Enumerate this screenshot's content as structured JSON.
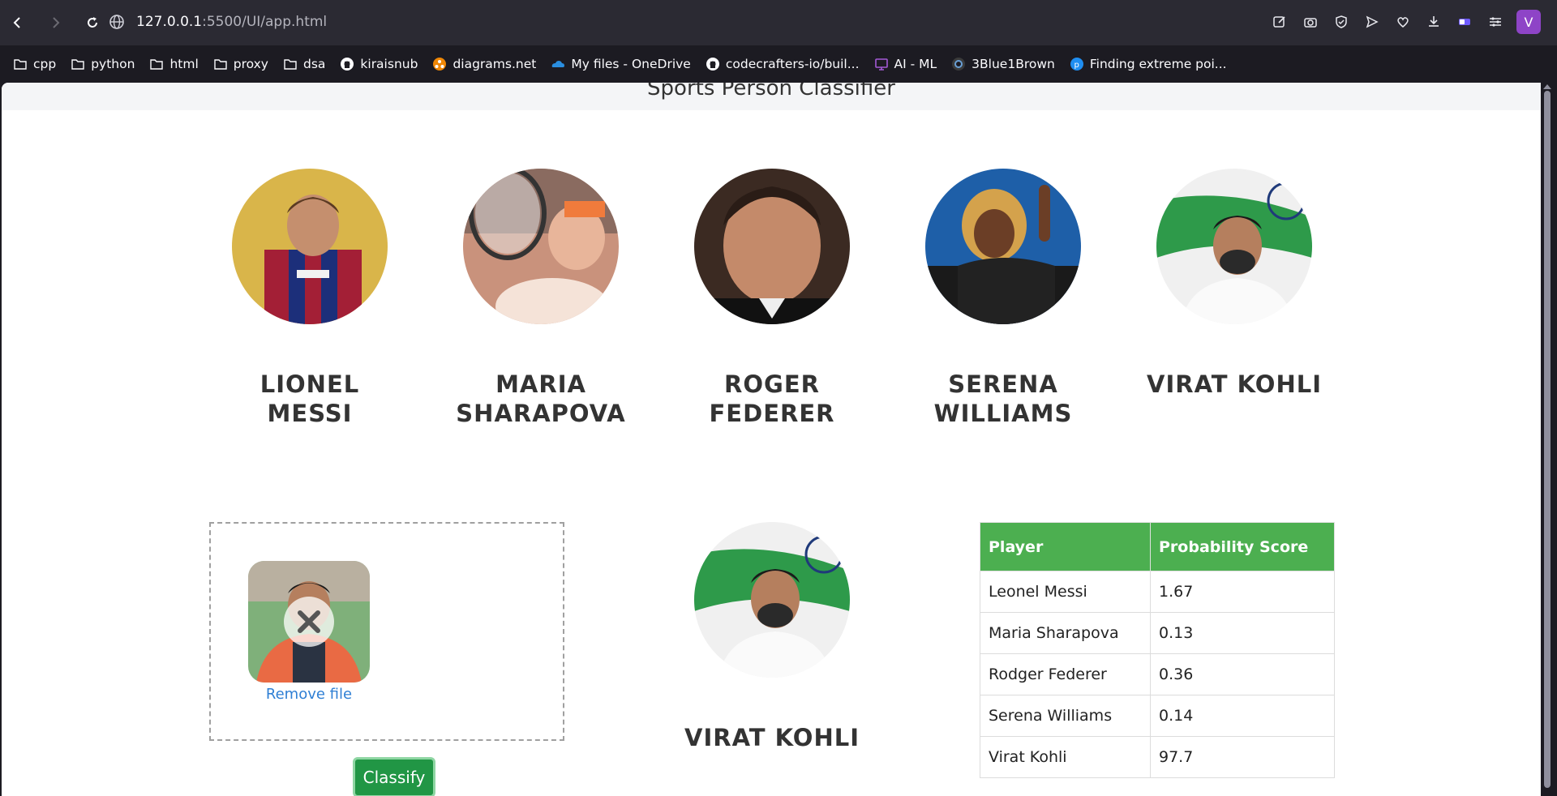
{
  "browser": {
    "url_host": "127.0.0.1",
    "url_rest": ":5500/UI/app.html",
    "profile_initial": "V",
    "bookmarks": [
      {
        "label": "cpp",
        "icon": "folder-icon"
      },
      {
        "label": "python",
        "icon": "folder-icon"
      },
      {
        "label": "html",
        "icon": "folder-icon"
      },
      {
        "label": "proxy",
        "icon": "folder-icon"
      },
      {
        "label": "dsa",
        "icon": "folder-icon"
      },
      {
        "label": "kiraisnub",
        "icon": "github-icon"
      },
      {
        "label": "diagrams.net",
        "icon": "diagrams-icon"
      },
      {
        "label": "My files - OneDrive",
        "icon": "onedrive-icon"
      },
      {
        "label": "codecrafters-io/buil...",
        "icon": "github-icon"
      },
      {
        "label": "AI - ML",
        "icon": "presentation-icon"
      },
      {
        "label": "3Blue1Brown",
        "icon": "3b1b-icon"
      },
      {
        "label": "Finding extreme poi...",
        "icon": "p-icon"
      }
    ]
  },
  "page": {
    "brand": "Sports Person Classifier",
    "players": [
      {
        "line1": "LIONEL",
        "line2": "MESSI"
      },
      {
        "line1": "MARIA",
        "line2": "SHARAPOVA"
      },
      {
        "line1": "ROGER",
        "line2": "FEDERER"
      },
      {
        "line1": "SERENA",
        "line2": "WILLIAMS"
      },
      {
        "line1": "VIRAT KOHLI",
        "line2": ""
      }
    ],
    "dropzone": {
      "remove_label": "Remove file"
    },
    "classify_label": "Classify",
    "result_name": "VIRAT KOHLI",
    "table": {
      "headers": [
        "Player",
        "Probability Score"
      ],
      "rows": [
        [
          "Leonel Messi",
          "1.67"
        ],
        [
          "Maria Sharapova",
          "0.13"
        ],
        [
          "Rodger Federer",
          "0.36"
        ],
        [
          "Serena Williams",
          "0.14"
        ],
        [
          "Virat Kohli",
          "97.7"
        ]
      ]
    }
  },
  "colors": {
    "table_header": "#4caf50",
    "classify_button": "#219645",
    "link": "#2f7fd4"
  }
}
